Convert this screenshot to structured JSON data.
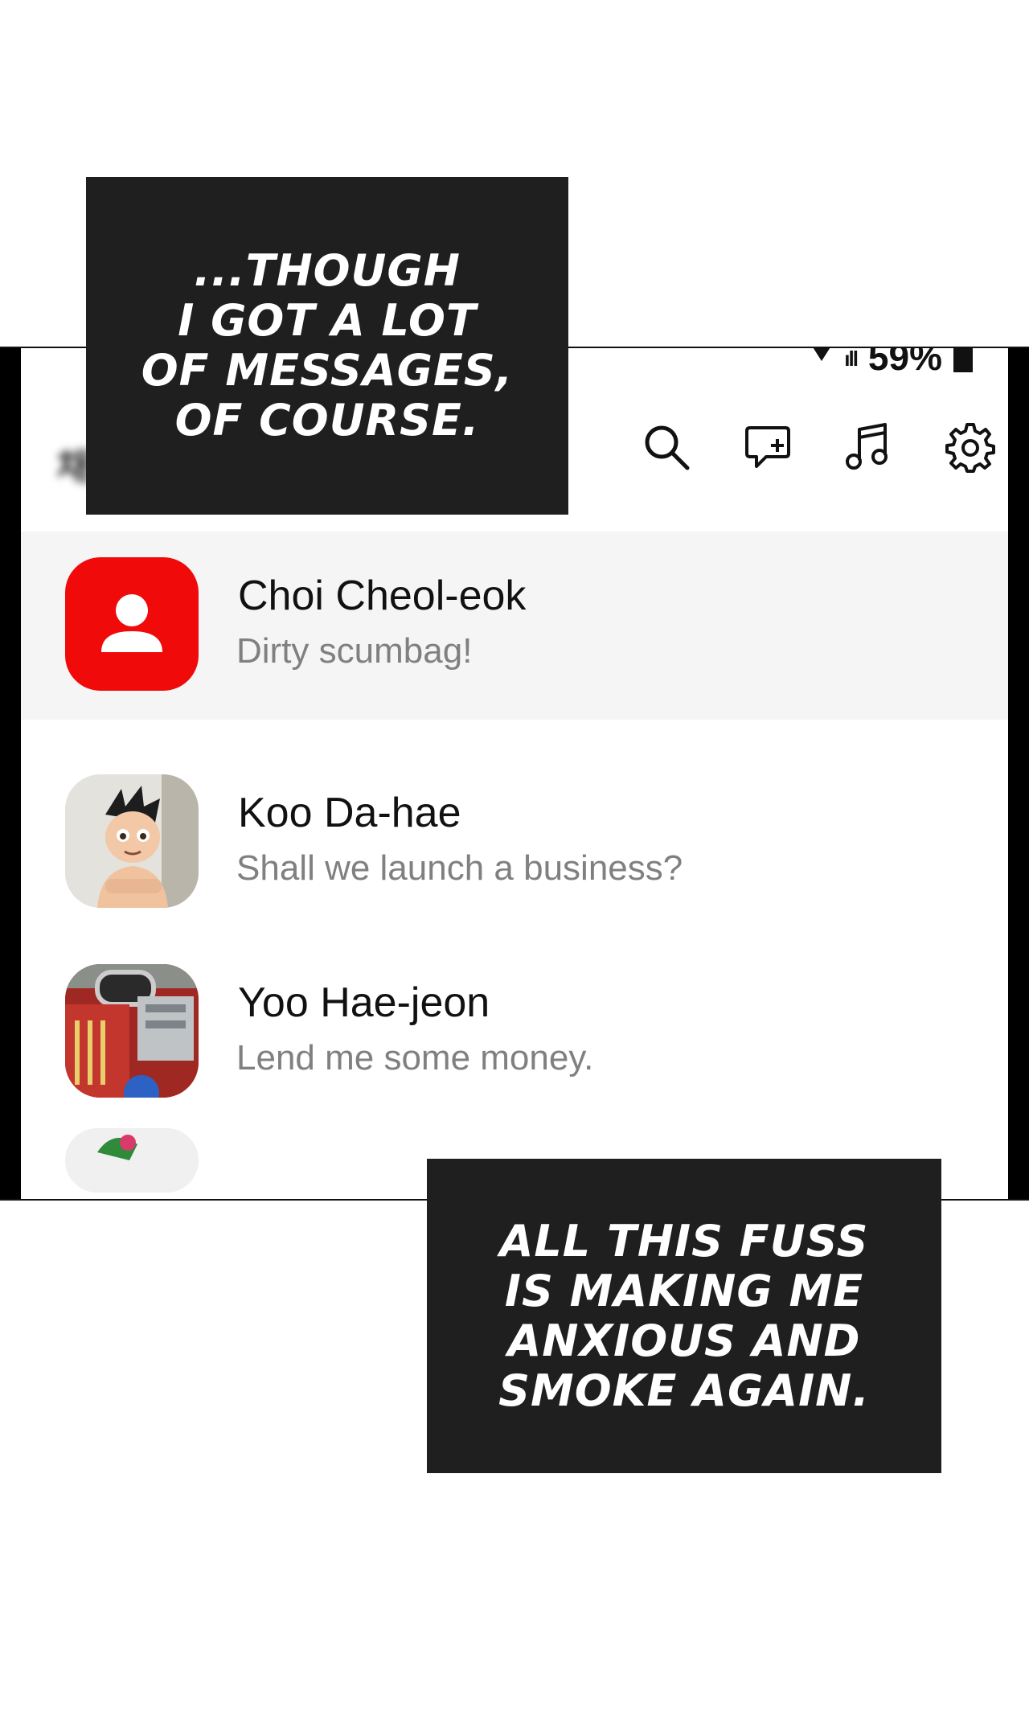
{
  "status_bar": {
    "battery": "59%",
    "signal": "ıll"
  },
  "app_title": "채팅",
  "toolbar": {
    "search": "search-icon",
    "new_chat": "new-chat-icon",
    "music": "music-icon",
    "settings": "gear-icon"
  },
  "chats": [
    {
      "name": "Choi Cheol-eok",
      "message": "Dirty scumbag!",
      "avatar": "default-person",
      "avatar_color": "#f00a0a"
    },
    {
      "name": "Koo Da-hae",
      "message": "Shall we launch a business?",
      "avatar": "astro-boy-figure"
    },
    {
      "name": "Yoo Hae-jeon",
      "message": "Lend me some money.",
      "avatar": "toy-car"
    }
  ],
  "captions": {
    "top": [
      "...THOUGH",
      "I GOT A LOT",
      "OF MESSAGES,",
      "OF COURSE."
    ],
    "bottom": [
      "ALL THIS FUSS",
      "IS MAKING ME",
      "ANXIOUS AND",
      "SMOKE AGAIN."
    ]
  }
}
